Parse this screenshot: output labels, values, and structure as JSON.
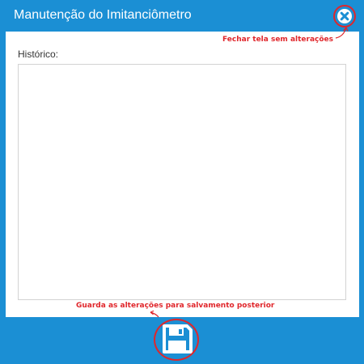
{
  "window": {
    "title": "Manutenção do Imitanciômetro",
    "header_color": "#1b8fd4"
  },
  "header": {
    "close_icon": "close-icon"
  },
  "form": {
    "history_label": "Histórico:",
    "history_value": ""
  },
  "footer": {
    "save_icon": "floppy-disk-icon"
  },
  "annotations": {
    "close_hint": "Fechar tela sem alterações",
    "save_hint": "Guarda as alterações para salvamento posterior",
    "color": "#e0262b"
  }
}
